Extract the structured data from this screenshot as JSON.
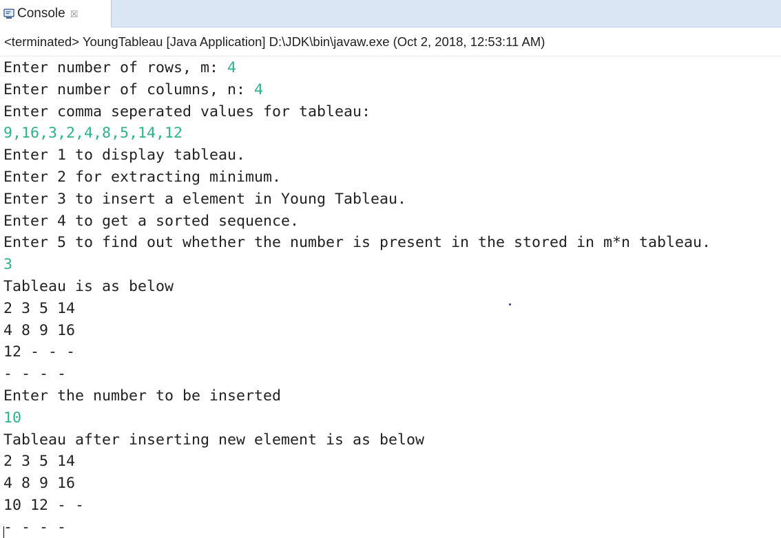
{
  "tab": {
    "label": "Console",
    "icon": "console-icon",
    "close_glyph": "☒",
    "close_icon": "close-icon"
  },
  "status_line": "<terminated> YoungTableau [Java Application] D:\\JDK\\bin\\javaw.exe (Oct 2, 2018, 12:53:11 AM)",
  "colors": {
    "tab_bar_bg": "#dbe6f4",
    "console_text": "#222222",
    "user_input": "#2bb288"
  },
  "console_lines": [
    {
      "prompt": "Enter number of rows, m: ",
      "input": "4"
    },
    {
      "prompt": "Enter number of columns, n: ",
      "input": "4"
    },
    {
      "prompt": "Enter comma seperated values for tableau:"
    },
    {
      "input": "9,16,3,2,4,8,5,14,12"
    },
    {
      "prompt": "Enter 1 to display tableau."
    },
    {
      "prompt": "Enter 2 for extracting minimum."
    },
    {
      "prompt": "Enter 3 to insert a element in Young Tableau."
    },
    {
      "prompt": "Enter 4 to get a sorted sequence."
    },
    {
      "prompt": "Enter 5 to find out whether the number is present in the stored in m*n tableau."
    },
    {
      "input": "3"
    },
    {
      "prompt": "Tableau is as below"
    },
    {
      "prompt": "2 3 5 14"
    },
    {
      "prompt": "4 8 9 16"
    },
    {
      "prompt": "12 - - -"
    },
    {
      "prompt": "- - - -"
    },
    {
      "prompt": "Enter the number to be inserted"
    },
    {
      "input": "10"
    },
    {
      "prompt": "Tableau after inserting new element is as below"
    },
    {
      "prompt": "2 3 5 14"
    },
    {
      "prompt": "4 8 9 16"
    },
    {
      "prompt": "10 12 - -"
    },
    {
      "prompt": "- - - -"
    }
  ]
}
